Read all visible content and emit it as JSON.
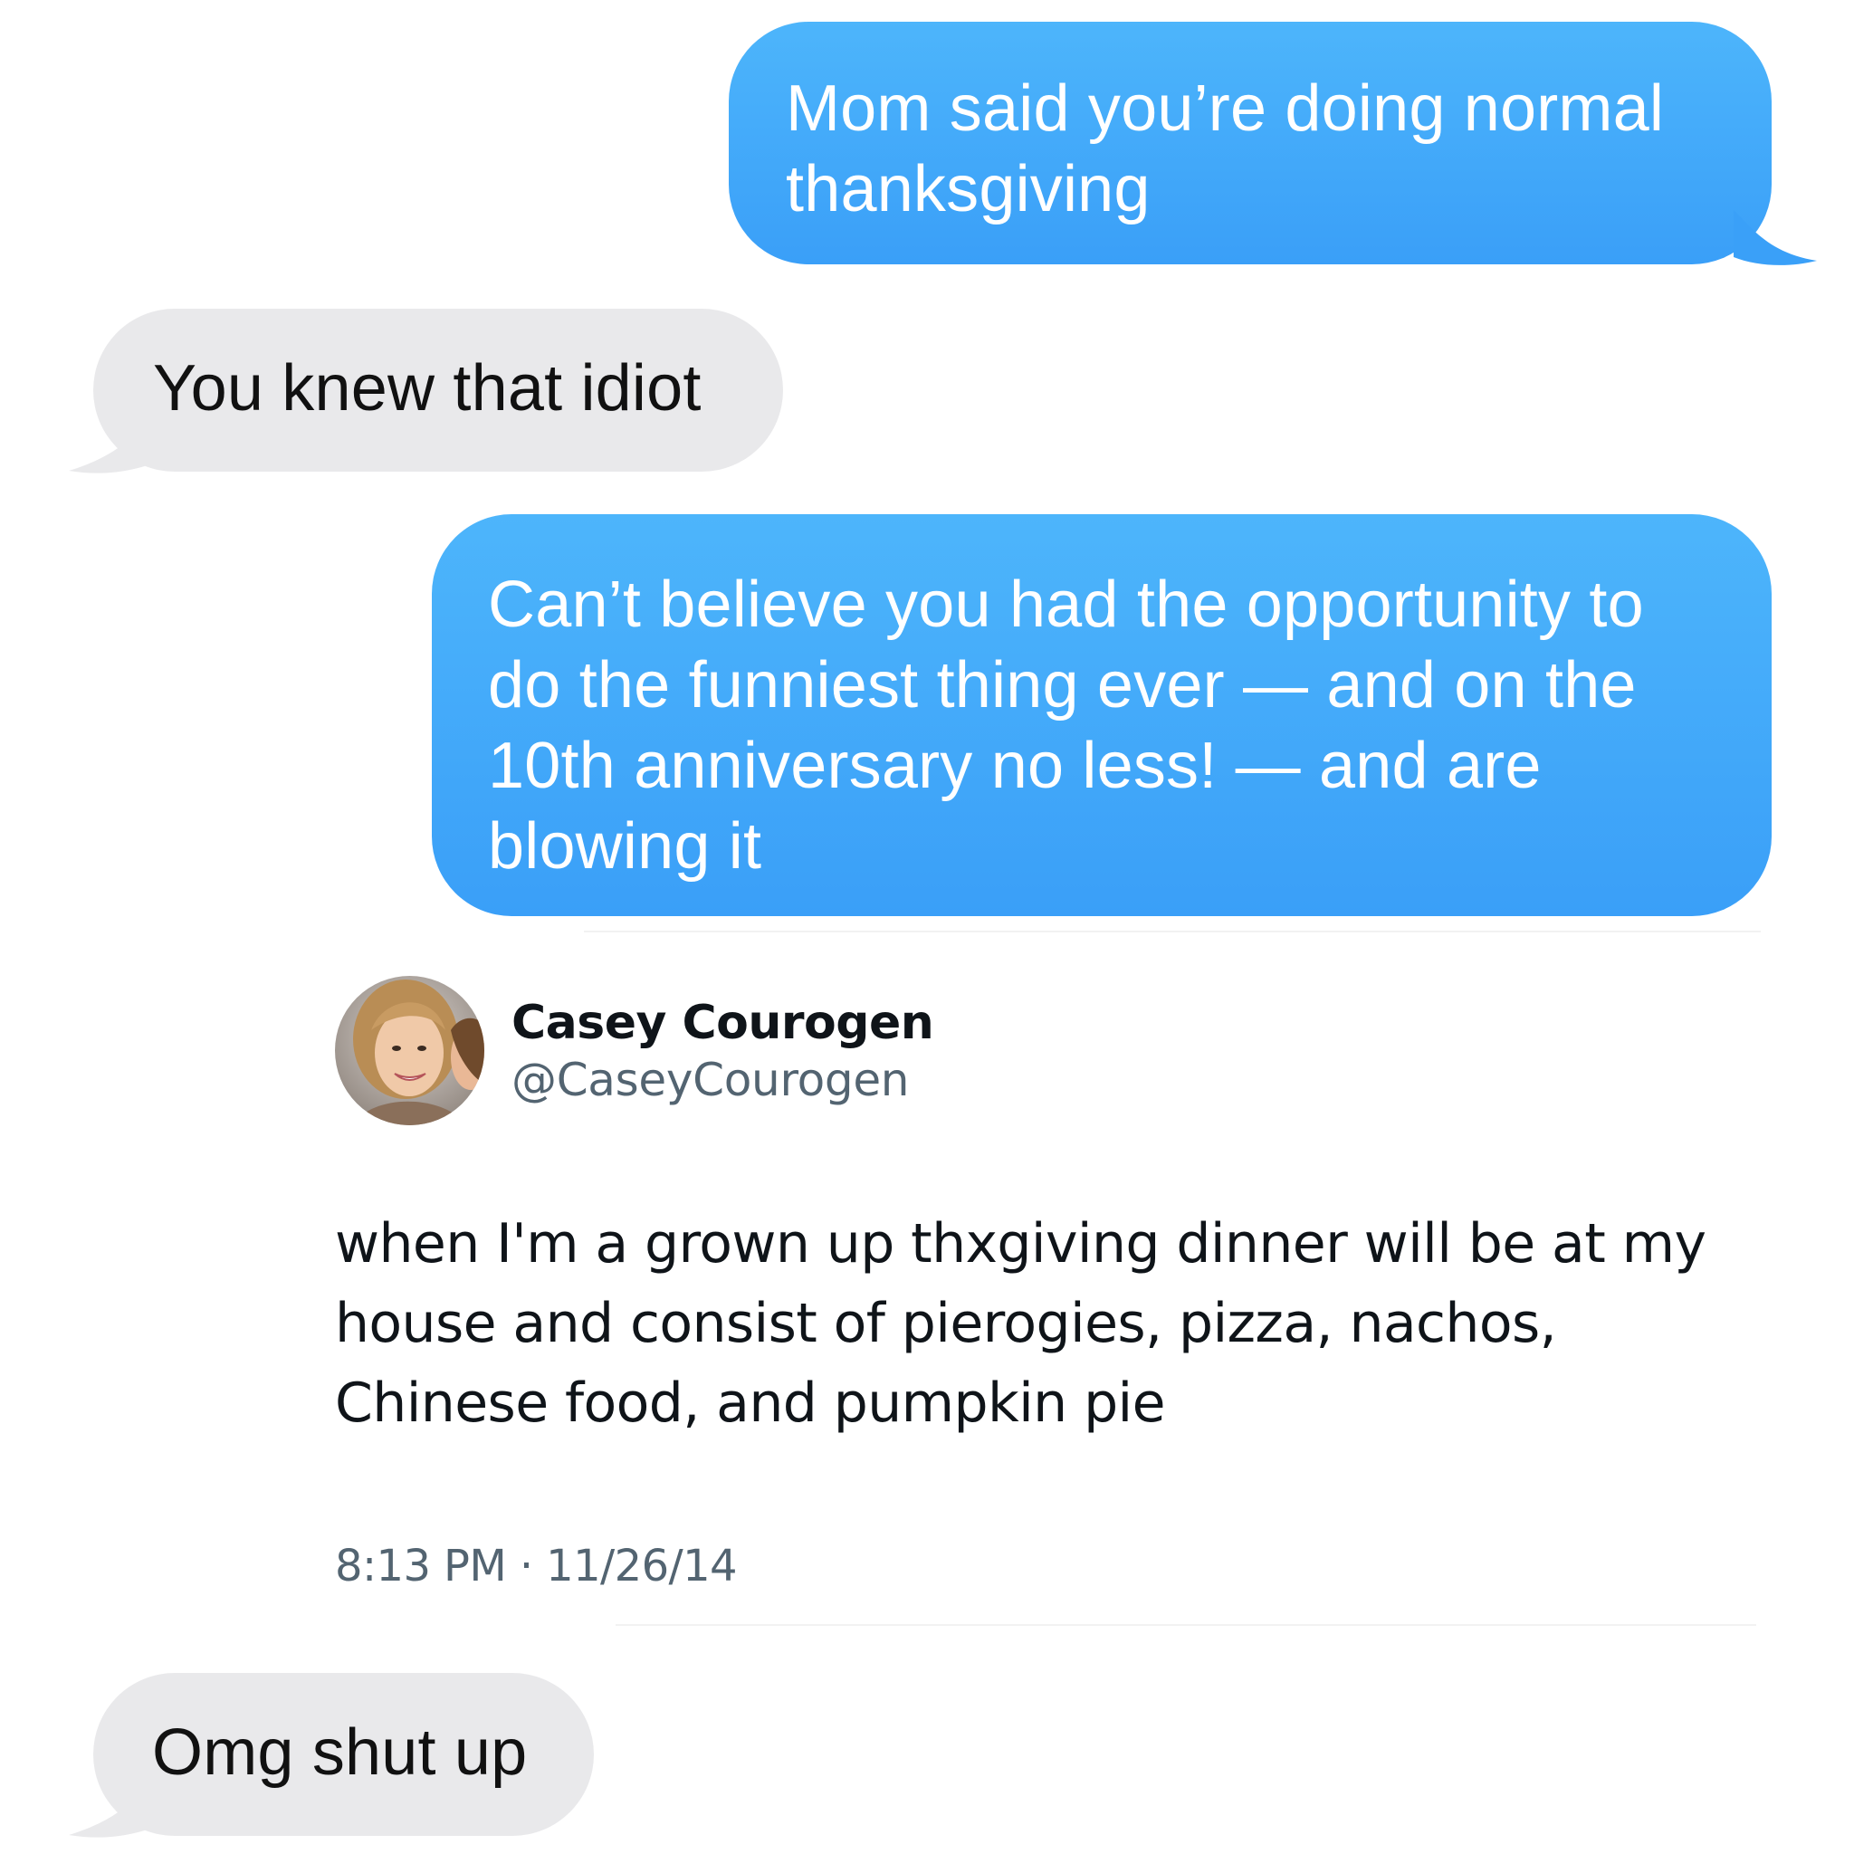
{
  "conversation": {
    "messages": [
      {
        "direction": "sent",
        "text": "Mom said you’re doing normal thanksgiving"
      },
      {
        "direction": "received",
        "text": "You knew that idiot"
      },
      {
        "direction": "sent",
        "text": "Can’t believe you had the opportunity to do the funniest thing ever — and on the 10th anniversary no less! — and are blowing it"
      },
      {
        "direction": "received",
        "text": "Omg shut up"
      }
    ],
    "colors": {
      "sent_bubble": "#3a9ff8",
      "received_bubble": "#e9e9eb",
      "sent_text": "#ffffff",
      "received_text": "#111111"
    }
  },
  "tweet": {
    "display_name": "Casey Courogen",
    "handle": "@CaseyCourogen",
    "text": "when I'm a grown up thxgiving dinner will be at my house and consist of pierogies, pizza, nachos, Chinese food, and pumpkin pie",
    "timestamp": "8:13 PM · 11/26/14",
    "avatar_icon": "profile-photo-avatar"
  }
}
